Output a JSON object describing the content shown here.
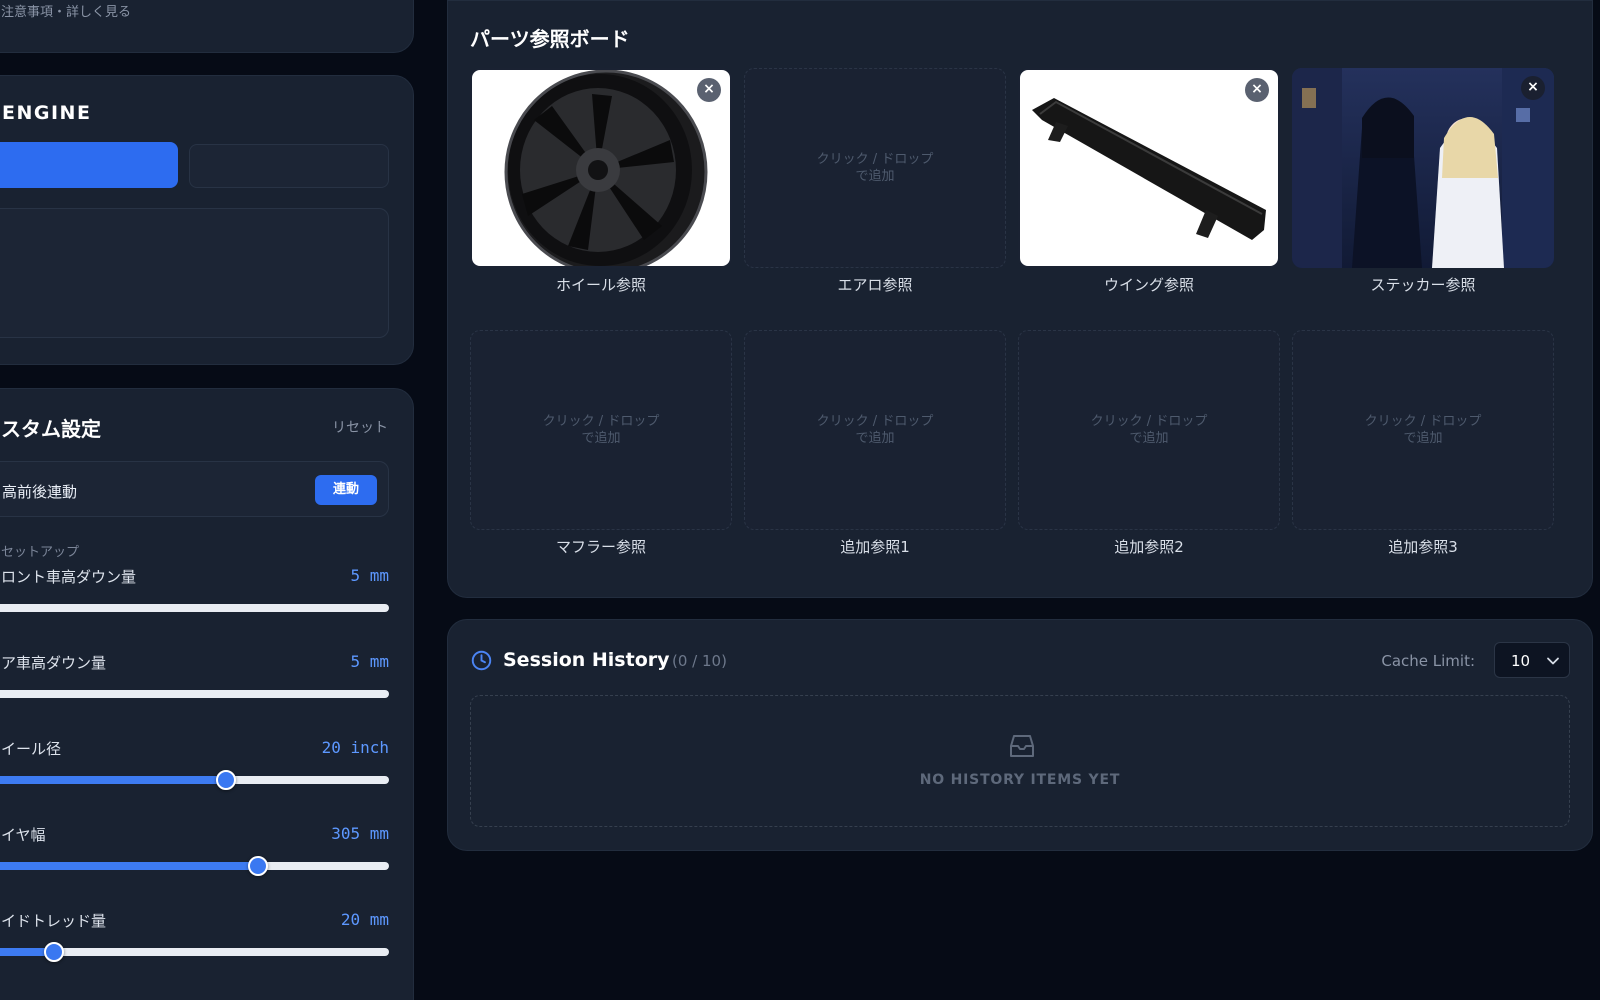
{
  "top_panel": {
    "notice": "注意事項・詳しく見る"
  },
  "engine": {
    "title": "ENGINE"
  },
  "custom": {
    "title": "スタム設定",
    "reset": "リセット",
    "sync": {
      "label": "高前後連動",
      "button": "連動"
    },
    "setup_label": "セットアップ",
    "sliders": [
      {
        "name": "ロント車高ダウン量",
        "value": "5 mm",
        "level": 0.0
      },
      {
        "name": "ア車高ダウン量",
        "value": "5 mm",
        "level": 0.0
      },
      {
        "name": "イール径",
        "value": "20 inch",
        "level": 0.6
      },
      {
        "name": "イヤ幅",
        "value": "305 mm",
        "level": 0.68
      },
      {
        "name": "イドトレッド量",
        "value": "20 mm",
        "level": 0.18
      }
    ]
  },
  "parts": {
    "title": "パーツ参照ボード",
    "empty_hint_line1": "クリック / ドロップ",
    "empty_hint_line2": "で追加",
    "slots": [
      {
        "label": "ホイール参照",
        "state": "filled",
        "icon": "wheel-image"
      },
      {
        "label": "エアロ参照",
        "state": "empty"
      },
      {
        "label": "ウイング参照",
        "state": "filled",
        "icon": "wing-image"
      },
      {
        "label": "ステッカー参照",
        "state": "filled",
        "icon": "sticker-illustration"
      },
      {
        "label": "マフラー参照",
        "state": "empty"
      },
      {
        "label": "追加参照1",
        "state": "empty"
      },
      {
        "label": "追加参照2",
        "state": "empty"
      },
      {
        "label": "追加参照3",
        "state": "empty"
      }
    ]
  },
  "history": {
    "title": "Session History",
    "count": "(0 / 10)",
    "cache_label": "Cache Limit:",
    "cache_value": "10",
    "empty_text": "NO HISTORY ITEMS YET"
  },
  "colors": {
    "accent": "#2d6cf0",
    "background": "#060b16",
    "panel": "#192231"
  }
}
